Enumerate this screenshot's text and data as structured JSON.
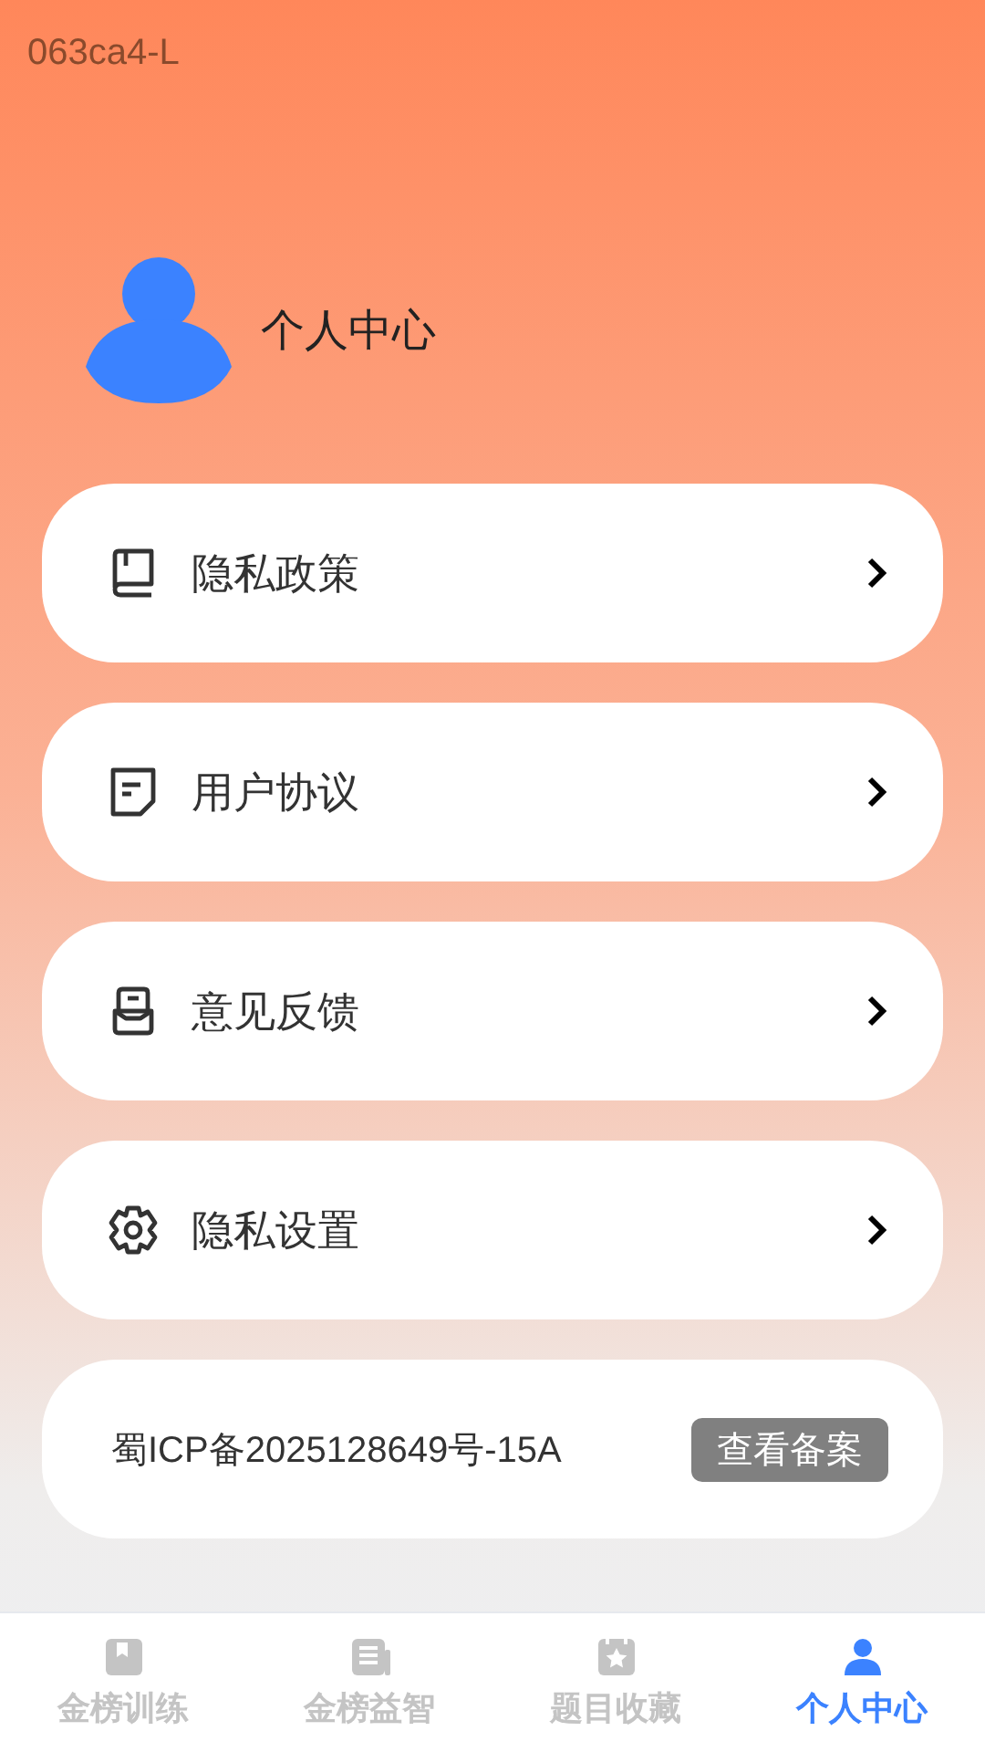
{
  "build_tag": "063ca4-L",
  "profile": {
    "title": "个人中心"
  },
  "menu": [
    {
      "label": "隐私政策"
    },
    {
      "label": "用户协议"
    },
    {
      "label": "意见反馈"
    },
    {
      "label": "隐私设置"
    }
  ],
  "icp": {
    "text": "蜀ICP备2025128649号-15A",
    "button": "查看备案"
  },
  "tabs": [
    {
      "label": "金榜训练",
      "selected": false
    },
    {
      "label": "金榜益智",
      "selected": false
    },
    {
      "label": "题目收藏",
      "selected": false
    },
    {
      "label": "个人中心",
      "selected": true
    }
  ]
}
